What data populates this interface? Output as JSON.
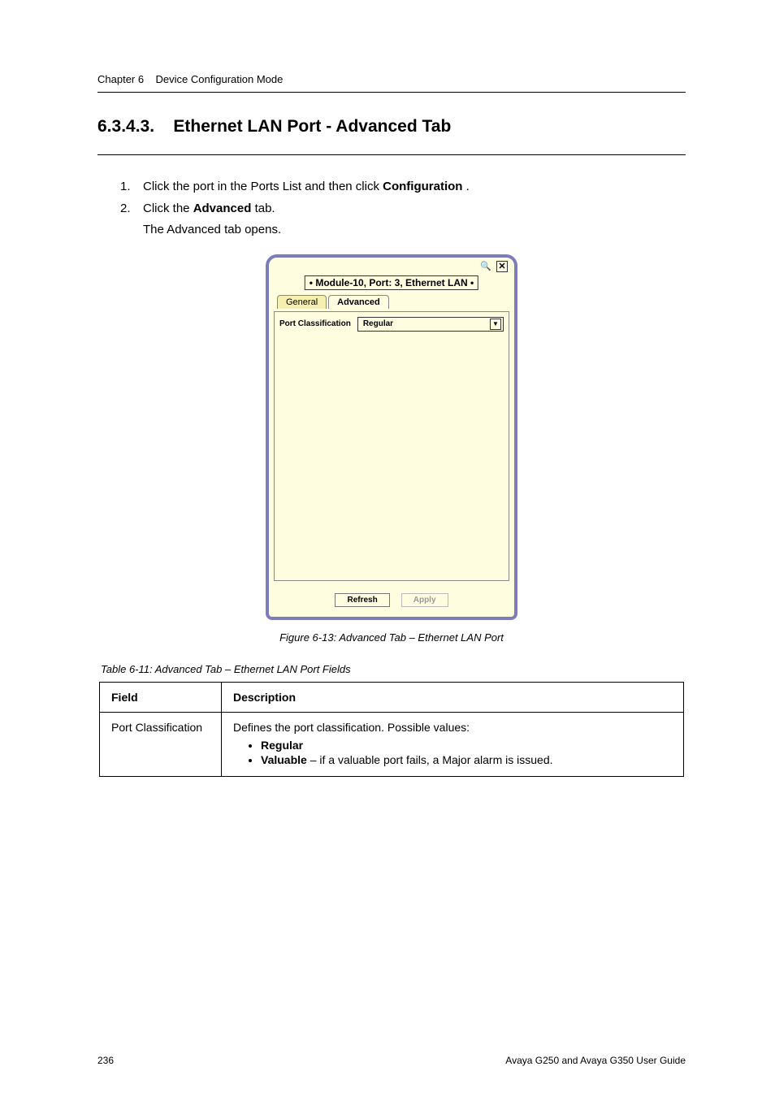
{
  "header": {
    "chapter_left": "Chapter 6",
    "chapter_right": "Device Configuration Mode"
  },
  "section": {
    "number": "6.3.4.3.",
    "title": "Ethernet LAN Port  - Advanced Tab"
  },
  "steps": [
    {
      "n": "1.",
      "text_pre": "Click the port in the Ports List and then click ",
      "bold": "Configuration",
      "text_post": "."
    },
    {
      "n": "2.",
      "text_pre": "Click the ",
      "bold": "Advanced",
      "text_post": " tab."
    }
  ],
  "sublabel": "The Advanced tab opens.",
  "screenshot": {
    "title": "Module-10, Port: 3, Ethernet LAN",
    "tabs": {
      "general": "General",
      "advanced": "Advanced"
    },
    "field_label": "Port Classification",
    "field_value": "Regular",
    "buttons": {
      "refresh": "Refresh",
      "apply": "Apply"
    },
    "icons": {
      "globe": "globe-icon",
      "close": "close-icon",
      "chevron": "▼"
    }
  },
  "figure_caption": "Figure 6-13: Advanced Tab – Ethernet LAN Port",
  "table": {
    "caption": "Table 6-11: Advanced Tab – Ethernet LAN Port Fields",
    "head_field": "Field",
    "head_desc": "Description",
    "row_field": "Port Classification",
    "row_desc_intro": "Defines the port classification. Possible values:",
    "row_items": [
      {
        "term": "Regular",
        "after": ""
      },
      {
        "term": "Valuable",
        "after": " – if a valuable port fails, a Major alarm is issued."
      }
    ]
  },
  "footer": {
    "left": "236",
    "right": "Avaya G250 and Avaya G350 User Guide"
  }
}
